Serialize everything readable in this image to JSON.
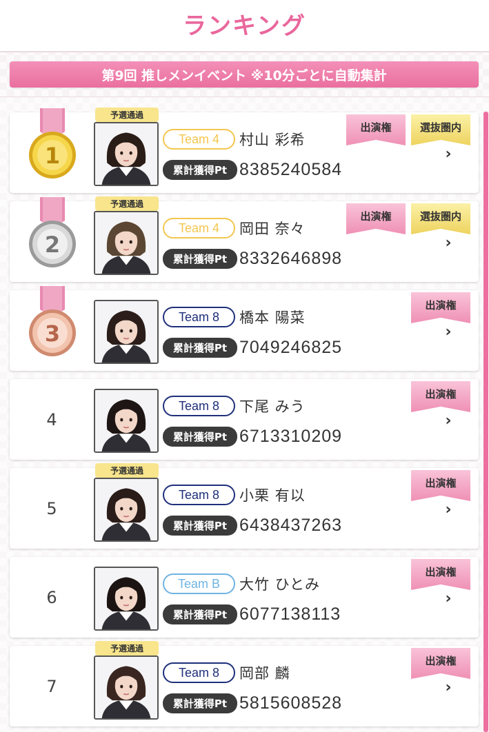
{
  "header": {
    "title": "ランキング"
  },
  "event": {
    "banner": "第9回 推しメンイベント ※10分ごとに自動集計"
  },
  "labels": {
    "prelim": "予選通過",
    "points": "累計獲得Pt",
    "tag_appear": "出演権",
    "tag_selected": "選抜圏内",
    "chevron": "›"
  },
  "colors": {
    "accent": "#e9679c",
    "team4": "#f3c64e",
    "team8": "#1e2f7a",
    "teamB": "#6fb3e2"
  },
  "rankings": [
    {
      "rank": "1",
      "medal": "gold",
      "prelim": true,
      "team": "Team 4",
      "team_key": "team4",
      "name": "村山 彩希",
      "points": "8385240584",
      "tags": [
        "出演権",
        "選抜圏内"
      ]
    },
    {
      "rank": "2",
      "medal": "silver",
      "prelim": true,
      "team": "Team 4",
      "team_key": "team4",
      "name": "岡田 奈々",
      "points": "8332646898",
      "tags": [
        "出演権",
        "選抜圏内"
      ]
    },
    {
      "rank": "3",
      "medal": "bronze",
      "prelim": false,
      "team": "Team 8",
      "team_key": "team8",
      "name": "橋本 陽菜",
      "points": "7049246825",
      "tags": [
        "出演権"
      ]
    },
    {
      "rank": "4",
      "medal": null,
      "prelim": false,
      "team": "Team 8",
      "team_key": "team8",
      "name": "下尾 みう",
      "points": "6713310209",
      "tags": [
        "出演権"
      ]
    },
    {
      "rank": "5",
      "medal": null,
      "prelim": true,
      "team": "Team 8",
      "team_key": "team8",
      "name": "小栗 有以",
      "points": "6438437263",
      "tags": [
        "出演権"
      ]
    },
    {
      "rank": "6",
      "medal": null,
      "prelim": false,
      "team": "Team B",
      "team_key": "teamB",
      "name": "大竹 ひとみ",
      "points": "6077138113",
      "tags": [
        "出演権"
      ]
    },
    {
      "rank": "7",
      "medal": null,
      "prelim": true,
      "team": "Team 8",
      "team_key": "team8",
      "name": "岡部 麟",
      "points": "5815608528",
      "tags": [
        "出演権"
      ]
    }
  ]
}
